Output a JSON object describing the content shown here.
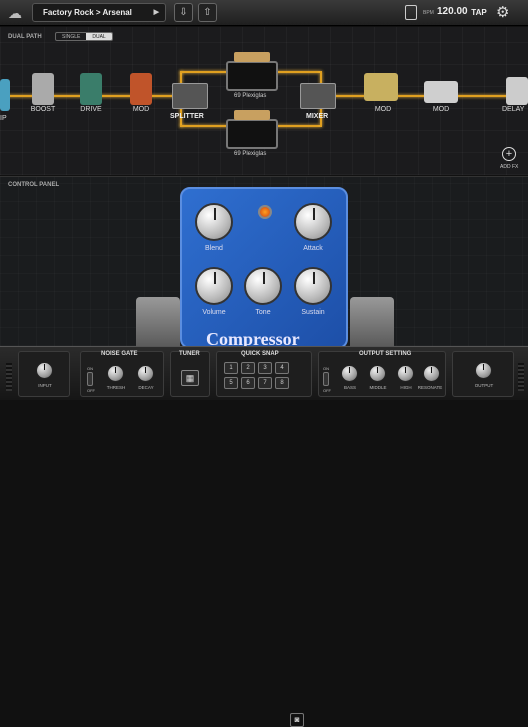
{
  "topbar": {
    "cloud_icon": "cloud-icon",
    "preset_bank": "Factory Rock",
    "preset_name": "Arsenal",
    "preset_separator": ">",
    "save_icon": "download-icon",
    "share_icon": "share-icon",
    "bpm_label": "BPM",
    "bpm_value": "120.00",
    "tap_label": "TAP",
    "settings_icon": "gear-icon"
  },
  "signal_chain": {
    "label": "DUAL PATH",
    "path_modes": [
      "SINGLE",
      "DUAL"
    ],
    "active_mode": "DUAL",
    "nodes": {
      "input_partial": "IP",
      "boost": "BOOST",
      "drive": "DRIVE",
      "mod_pre": "MOD",
      "splitter": "SPLITTER",
      "amp_top": "69 Plexiglas",
      "amp_bottom": "69 Plexiglas",
      "mixer": "MIXER",
      "mod_post_1": "MOD",
      "mod_post_2": "MOD",
      "delay": "DELAY"
    },
    "add_fx": "ADD FX",
    "wire_color": "#e0a020"
  },
  "control_panel": {
    "label": "CONTROL PANEL",
    "pedal_name": "Compressor",
    "knobs": [
      "Blend",
      "Attack",
      "Volume",
      "Tone",
      "Sustain"
    ],
    "pedal_color": "#2f6fd0"
  },
  "bottom": {
    "input": {
      "label": "INPUT"
    },
    "noise_gate": {
      "title": "NOISE GATE",
      "switch_on": "ON",
      "switch_off": "OFF",
      "knobs": [
        "THRESH",
        "DECAY"
      ]
    },
    "tuner": {
      "title": "TUNER"
    },
    "quick_snap": {
      "title": "QUICK SNAP",
      "slots": [
        "1",
        "2",
        "3",
        "4",
        "5",
        "6",
        "7",
        "8"
      ]
    },
    "output_setting": {
      "title": "OUTPUT SETTING",
      "switch_on": "ON",
      "switch_off": "OFF",
      "knobs": [
        "BASS",
        "MIDDLE",
        "HIGH",
        "RESONATE"
      ]
    },
    "output": {
      "label": "OUTPUT"
    }
  }
}
